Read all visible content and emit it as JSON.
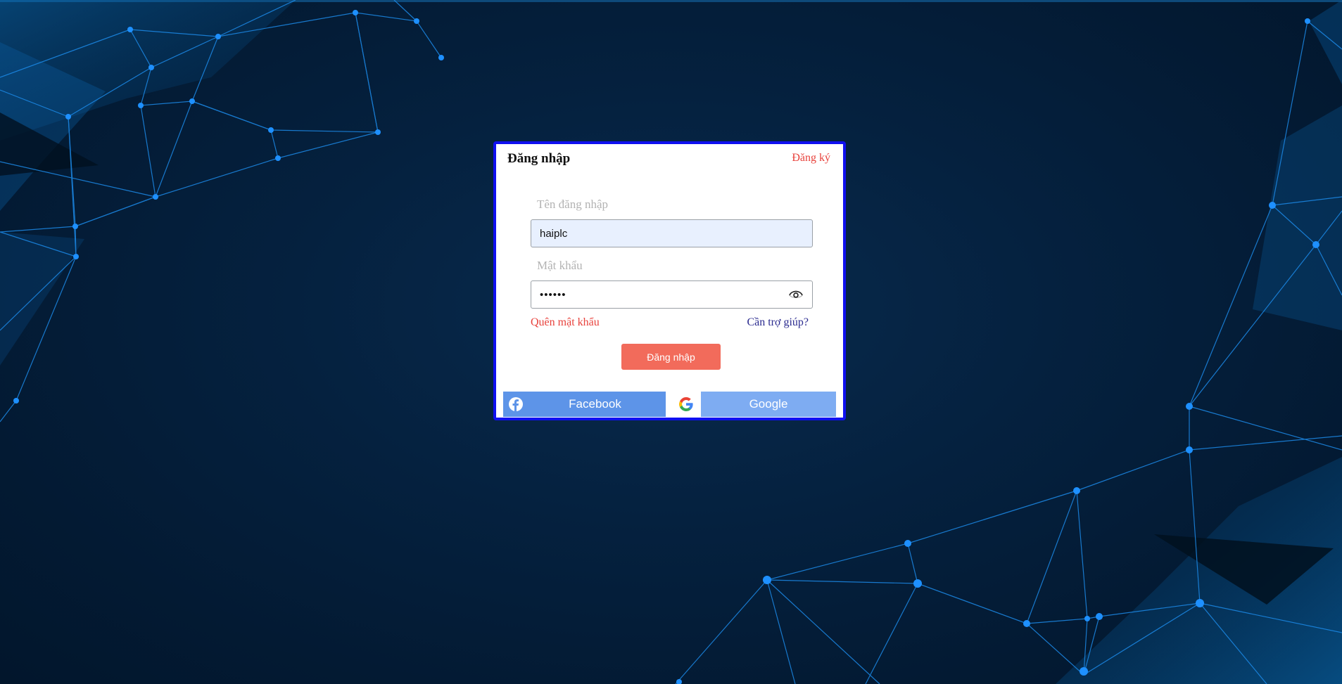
{
  "login_card": {
    "title": "Đăng nhập",
    "register_link": "Đăng ký",
    "username_label": "Tên đăng nhập",
    "username_value": "haiplc",
    "password_label": "Mật khẩu",
    "password_value": "••••••",
    "forgot_password": "Quên mật khẩu",
    "need_help": "Cần trợ giúp?",
    "login_button": "Đăng nhập",
    "facebook_button": "Facebook",
    "google_button": "Google"
  },
  "icons": {
    "password_toggle": "eye-icon",
    "facebook": "facebook-icon",
    "google": "google-icon"
  },
  "colors": {
    "card_border": "#1010f0",
    "accent_red": "#e8423c",
    "login_button": "#f26b5b",
    "facebook_button": "#5d94e8",
    "google_button": "#7eacf2",
    "help_link": "#2b2b8f"
  }
}
